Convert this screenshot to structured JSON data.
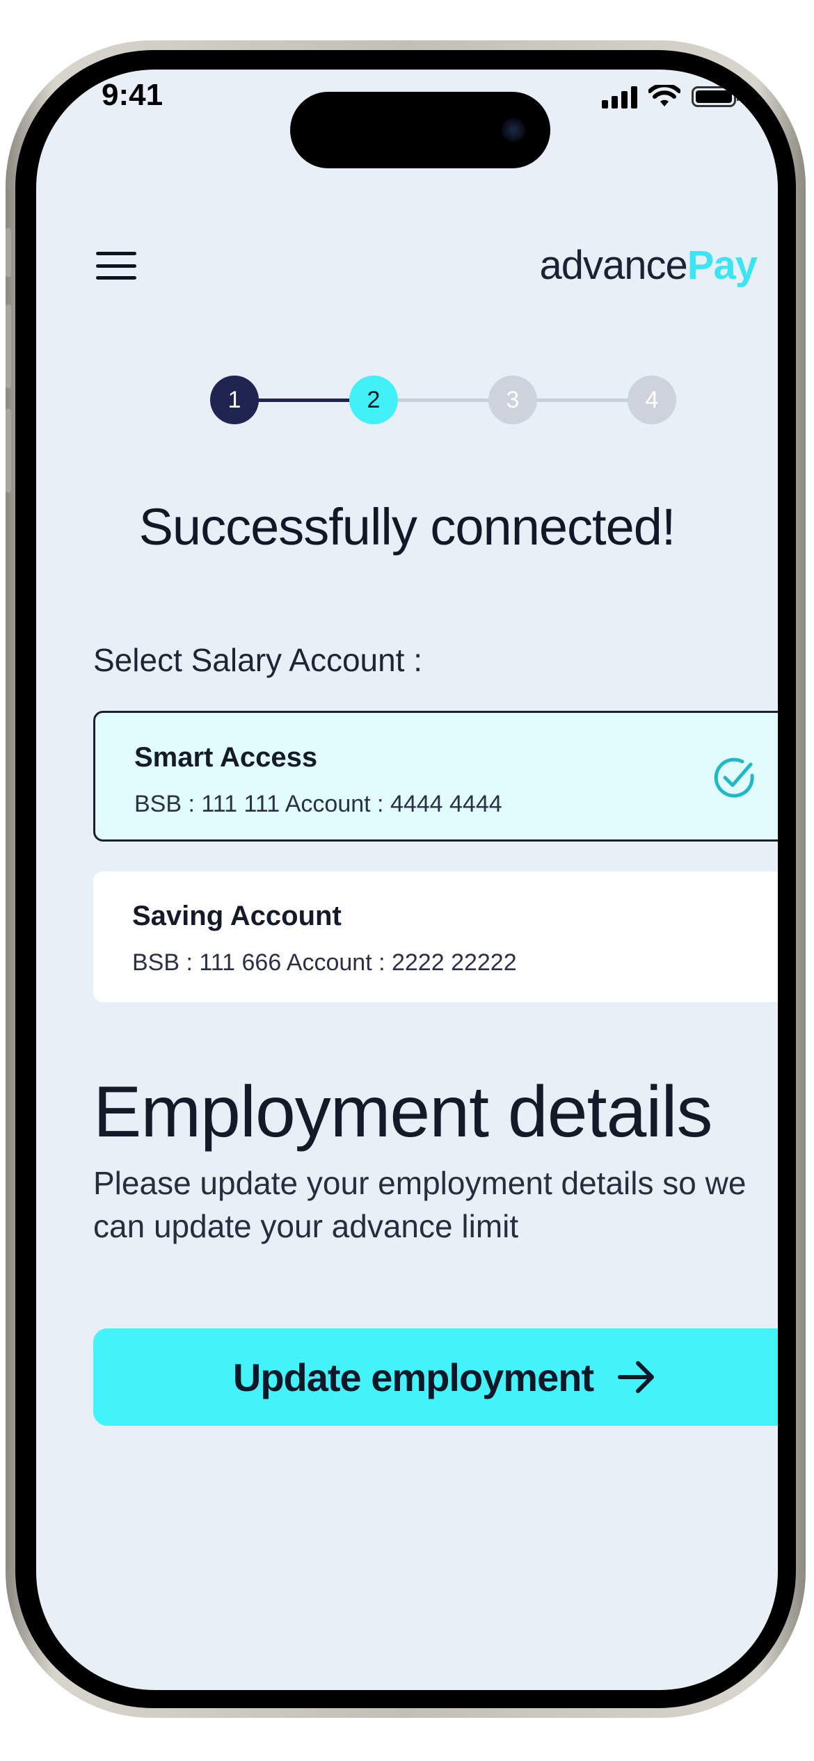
{
  "status_bar": {
    "time": "9:41",
    "icons": [
      "cellular-signal-icon",
      "wifi-icon",
      "battery-icon"
    ]
  },
  "header": {
    "menu_icon": "hamburger-menu-icon",
    "logo": {
      "part1": "advance",
      "part2": "Pay"
    }
  },
  "stepper": {
    "steps": [
      {
        "label": "1",
        "state": "done"
      },
      {
        "label": "2",
        "state": "active"
      },
      {
        "label": "3",
        "state": "pending"
      },
      {
        "label": "4",
        "state": "pending"
      }
    ]
  },
  "page": {
    "title": "Successfully connected!",
    "select_label": "Select Salary Account :"
  },
  "accounts": [
    {
      "name": "Smart Access",
      "details": "BSB : 111 111  Account : 4444 4444",
      "selected": true
    },
    {
      "name": "Saving Account",
      "details": "BSB : 111 666  Account : 2222 22222",
      "selected": false
    }
  ],
  "employment": {
    "title": "Employment details",
    "description": "Please update your employment details so we can update your advance limit",
    "button_label": "Update employment"
  },
  "colors": {
    "background": "#e9eff7",
    "accent": "#42f4fa",
    "navy": "#1f2550",
    "selected_card": "#e0fcfd",
    "check_teal": "#1fb8c4"
  }
}
